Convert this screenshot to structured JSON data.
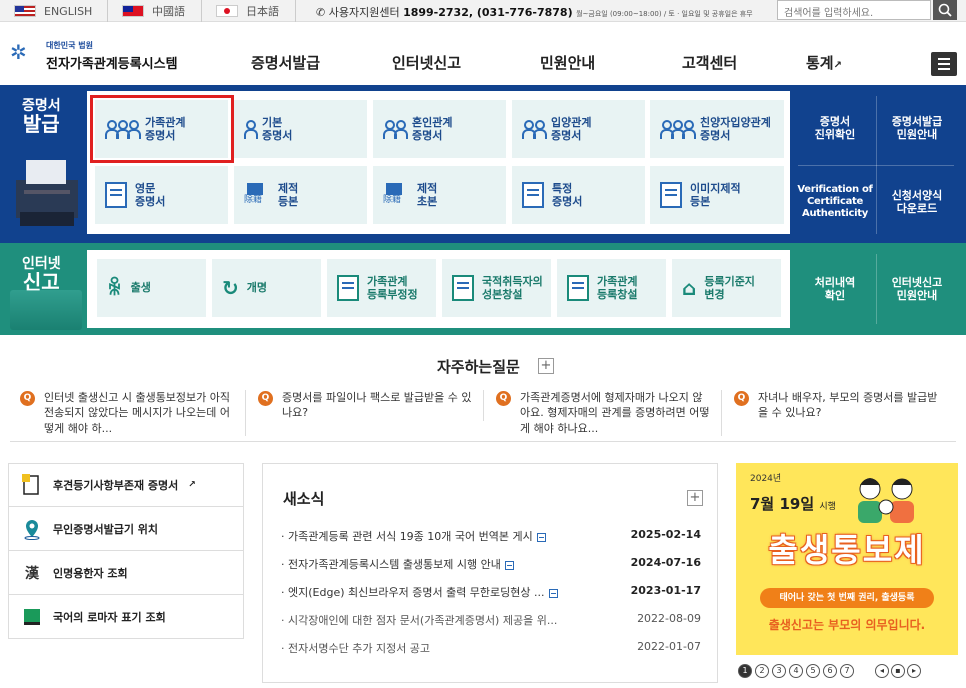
{
  "topbar": {
    "lang_en": "ENGLISH",
    "lang_tw": "中國語",
    "lang_jp": "日本語",
    "support_label": "사용자지원센터",
    "support_phone": "1899-2732, (031-776-7878)",
    "support_hours": "월~금요일 (09:00~18:00) / 토 · 일요일 및 공휴일은 휴무",
    "search_placeholder": "검색어를 입력하세요."
  },
  "logo": {
    "ministry": "대한민국 법원",
    "name": "전자가족관계등록시스템"
  },
  "nav": {
    "items": [
      "증명서발급",
      "인터넷신고",
      "민원안내",
      "고객센터",
      "통계"
    ]
  },
  "cert": {
    "title_top": "증명서",
    "title_bottom": "발급",
    "cards": [
      {
        "label": "가족관계\n증명서",
        "icon": "family-icon"
      },
      {
        "label": "기본\n증명서",
        "icon": "person-icon"
      },
      {
        "label": "혼인관계\n증명서",
        "icon": "couple-icon"
      },
      {
        "label": "입양관계\n증명서",
        "icon": "adoption-icon"
      },
      {
        "label": "친양자입양관계\n증명서",
        "icon": "full-adoption-icon"
      },
      {
        "label": "영문\n증명서",
        "icon": "english-doc-icon"
      },
      {
        "label": "제적\n등본",
        "icon": "removed-register-icon"
      },
      {
        "label": "제적\n초본",
        "icon": "removed-abstract-icon"
      },
      {
        "label": "특정\n증명서",
        "icon": "specific-doc-icon"
      },
      {
        "label": "이미지제적\n등본",
        "icon": "image-register-icon"
      }
    ],
    "side": [
      "증명서\n진위확인",
      "증명서발급\n민원안내",
      "Verification of\nCertificate\nAuthenticity",
      "신청서양식\n다운로드"
    ]
  },
  "report": {
    "title_top": "인터넷",
    "title_bottom": "신고",
    "cards": [
      {
        "label": "출생"
      },
      {
        "label": "개명"
      },
      {
        "label": "가족관계\n등록부정정"
      },
      {
        "label": "국적취득자의\n성본창설"
      },
      {
        "label": "가족관계\n등록창설"
      },
      {
        "label": "등록기준지\n변경"
      }
    ],
    "side": [
      "처리내역\n확인",
      "인터넷신고\n민원안내"
    ]
  },
  "faq": {
    "title": "자주하는질문",
    "plus": "+",
    "items": [
      "인터넷 출생신고 시 출생통보정보가 아직 전송되지 않았다는 메시지가 나오는데 어떻게 해야 하...",
      "증명서를 파일이나 팩스로 발급받을 수 있나요?",
      "가족관계증명서에 형제자매가 나오지 않아요. 형제자매의 관계를 증명하려면 어떻게 해야 하나요...",
      "자녀나 배우자, 부모의 증명서를 발급받을 수 있나요?"
    ],
    "q": "Q"
  },
  "quick": [
    {
      "label": "후견등기사항부존재 증명서"
    },
    {
      "label": "무인증명서발급기 위치"
    },
    {
      "label": "인명용한자 조회"
    },
    {
      "label": "국어의 로마자 표기 조회"
    }
  ],
  "news": {
    "title": "새소식",
    "plus": "+",
    "items": [
      {
        "title": "가족관계등록 관련 서식 19종 10개 국어 번역본 게시",
        "date": "2025-02-14",
        "new": true
      },
      {
        "title": "전자가족관계등록시스템 출생통보제 시행 안내",
        "date": "2024-07-16",
        "new": true
      },
      {
        "title": "엣지(Edge) 최신브라우저 증명서 출력 무한로딩현상 ...",
        "date": "2023-01-17",
        "new": true
      },
      {
        "title": "시각장애인에 대한 점자 문서(가족관계증명서) 제공을 위...",
        "date": "2022-08-09",
        "new": false
      },
      {
        "title": "전자서명수단 추가 지정서 공고",
        "date": "2022-01-07",
        "new": false
      }
    ]
  },
  "banner": {
    "year": "2024년",
    "date": "7월 19일",
    "date_suffix": "시행",
    "title": "출생통보제",
    "pill": "태어나 갖는 첫 번째 권리, 출생등록",
    "footer": "출생신고는 부모의 의무입니다.",
    "pages": [
      "1",
      "2",
      "3",
      "4",
      "5",
      "6",
      "7"
    ],
    "active_page": 1
  },
  "colors": {
    "cert_band": "#11428e",
    "report_band": "#1f8f7d",
    "highlight": "#e02020",
    "banner": "#ffe65a"
  }
}
